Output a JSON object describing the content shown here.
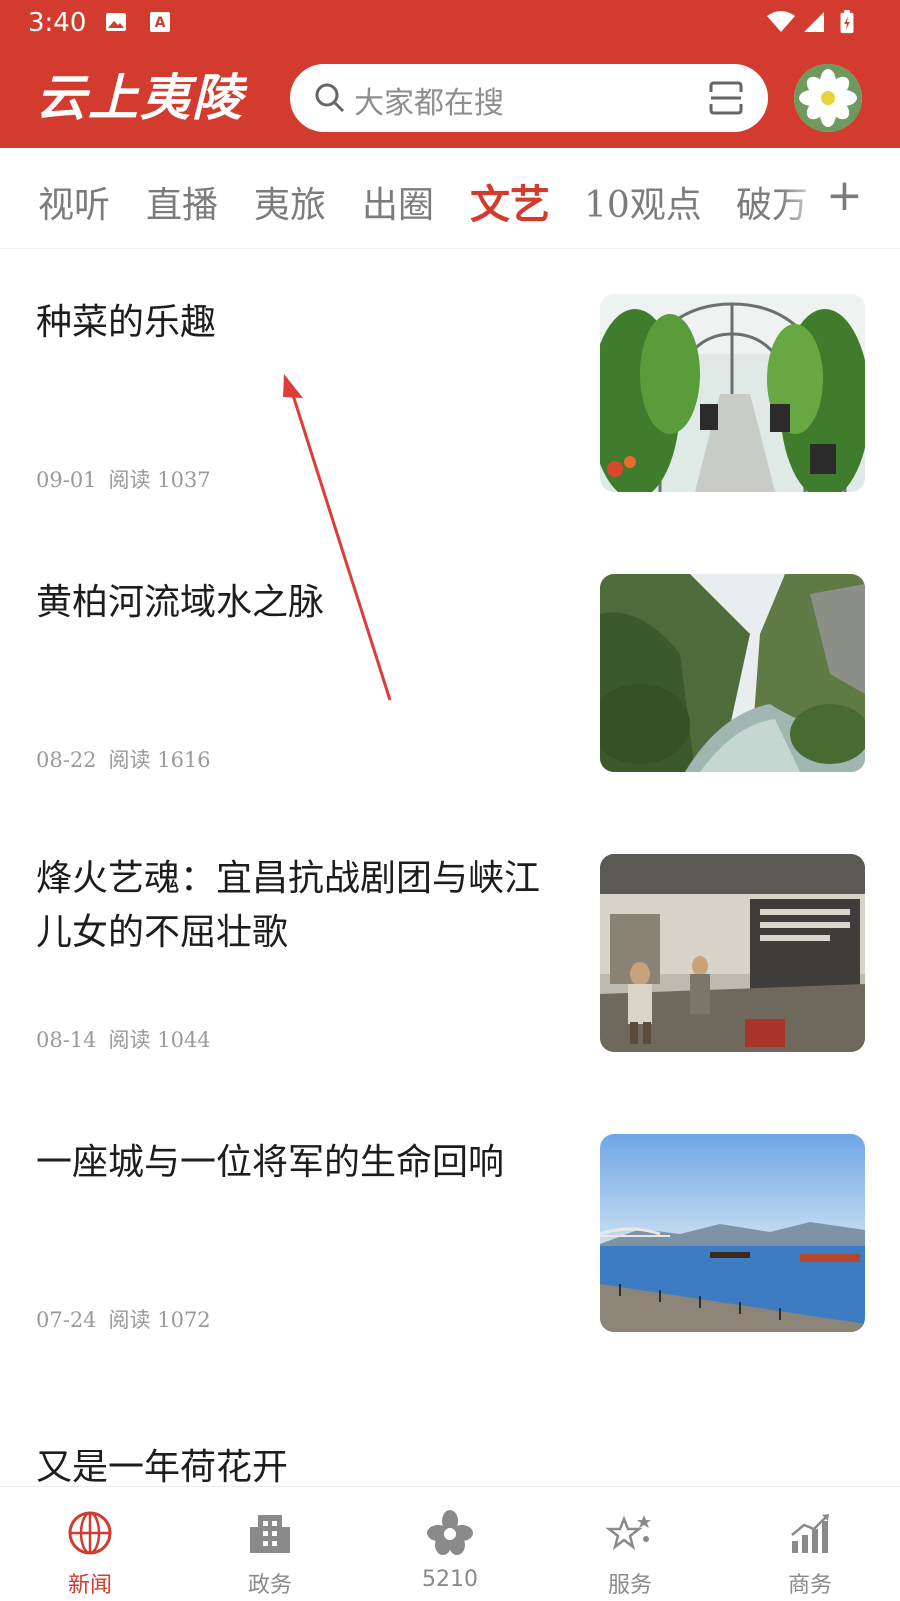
{
  "status_bar": {
    "time": "3:40"
  },
  "header": {
    "logo_text": "云上夷陵",
    "search_placeholder": "大家都在搜",
    "accent_color": "#d23b2d"
  },
  "tabs": [
    {
      "label": "视听",
      "active": false
    },
    {
      "label": "直播",
      "active": false
    },
    {
      "label": "夷旅",
      "active": false
    },
    {
      "label": "出圈",
      "active": false
    },
    {
      "label": "文艺",
      "active": true
    },
    {
      "label": "10观点",
      "active": false
    },
    {
      "label": "破万",
      "active": false
    }
  ],
  "articles": [
    {
      "title": "种菜的乐趣",
      "date": "09-01",
      "reads": "阅读 1037",
      "image": "greenhouse-photo"
    },
    {
      "title": "黄柏河流域水之脉",
      "date": "08-22",
      "reads": "阅读 1616",
      "image": "river-gorge-photo"
    },
    {
      "title": "烽火艺魂：宜昌抗战剧团与峡江儿女的不屈壮歌",
      "date": "08-14",
      "reads": "阅读 1044",
      "image": "museum-exhibit-photo"
    },
    {
      "title": "一座城与一位将军的生命回响",
      "date": "07-24",
      "reads": "阅读 1072",
      "image": "riverside-city-photo"
    },
    {
      "title": "又是一年荷花开"
    }
  ],
  "bottom_nav": [
    {
      "label": "新闻",
      "icon": "globe-icon",
      "active": true
    },
    {
      "label": "政务",
      "icon": "building-icon",
      "active": false
    },
    {
      "label": "5210",
      "icon": "flower-emblem-icon",
      "active": false
    },
    {
      "label": "服务",
      "icon": "stars-icon",
      "active": false
    },
    {
      "label": "商务",
      "icon": "chart-growth-icon",
      "active": false
    }
  ]
}
